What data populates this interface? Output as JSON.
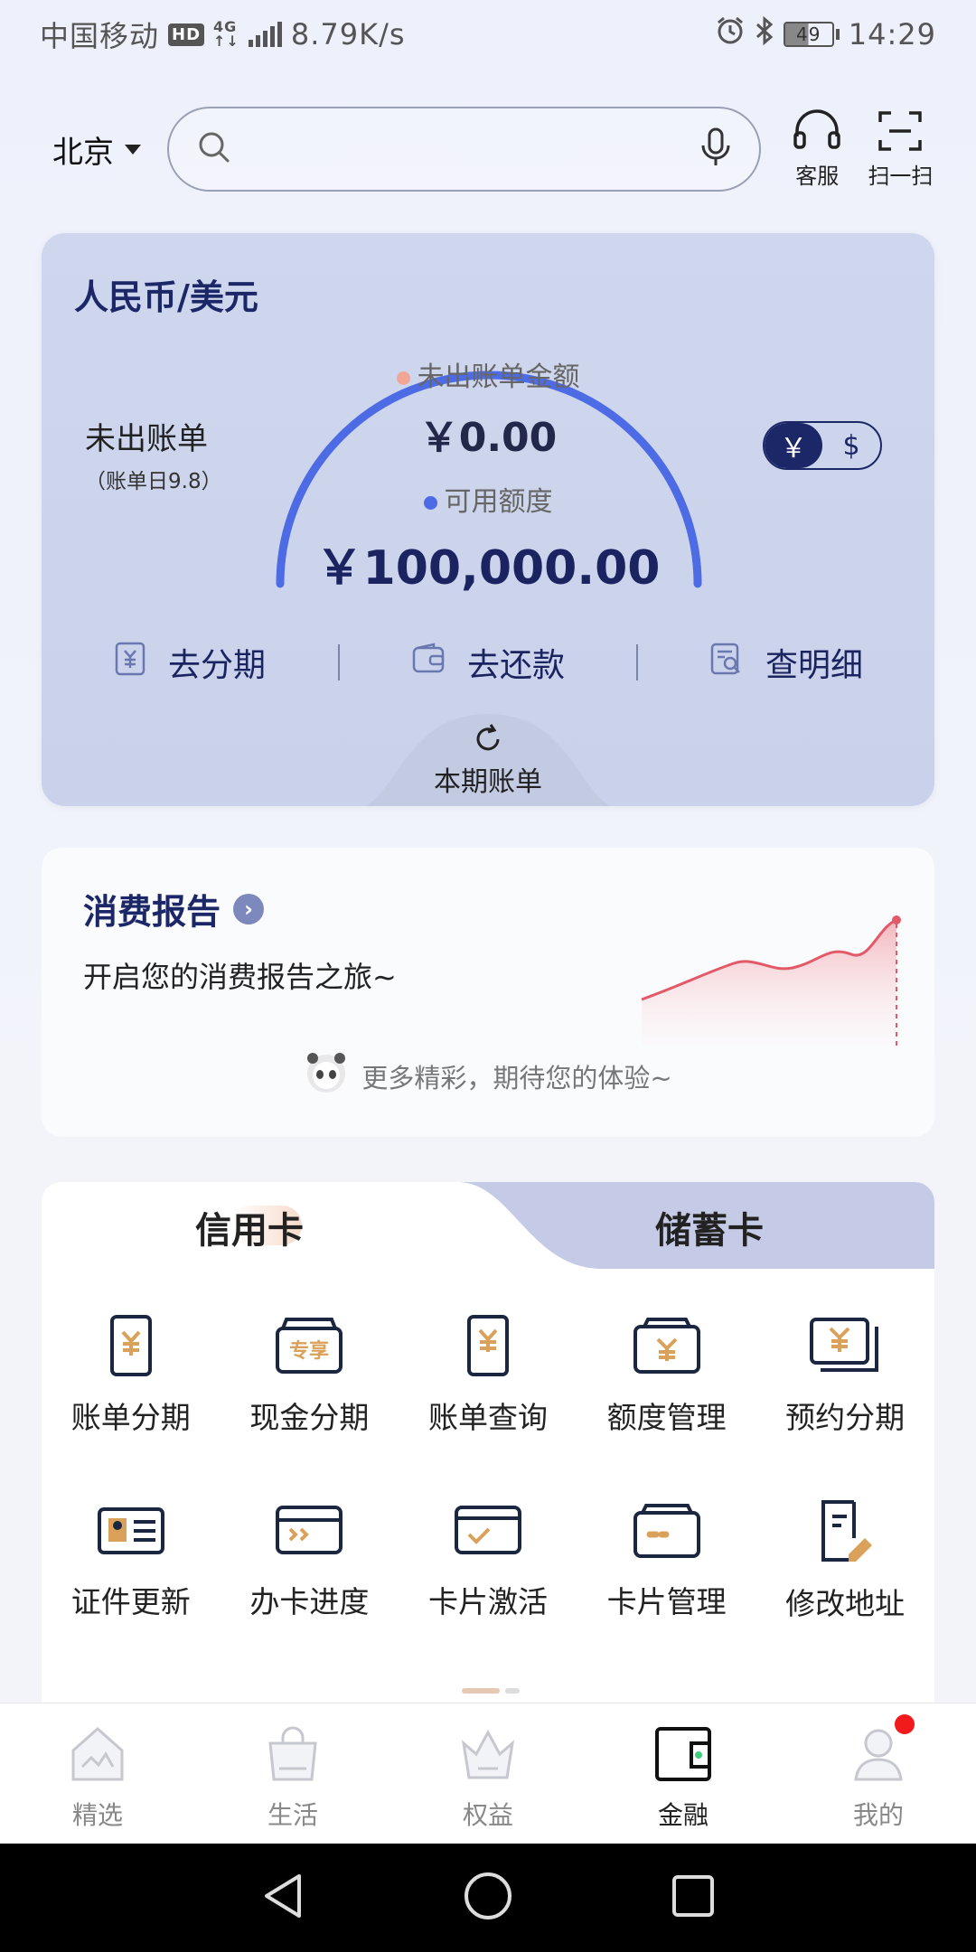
{
  "status_bar": {
    "carrier": "中国移动",
    "hd": "HD",
    "net_type_top": "4G",
    "net_type_bottom": "↑↓",
    "speed": "8.79K/s",
    "battery": "49",
    "time": "14:29"
  },
  "header": {
    "city": "北京",
    "search_placeholder": "",
    "service_label": "客服",
    "scan_label": "扫一扫"
  },
  "bill_card": {
    "title": "人民币/美元",
    "unbilled_label": "未出账单",
    "unbilled_sub": "（账单日9.8）",
    "unbilled_amount_label": "未出账单金额",
    "unbilled_amount": "￥0.00",
    "available_label": "可用额度",
    "available_amount": "￥100,000.00",
    "toggle_cny": "￥",
    "toggle_usd": "$",
    "actions": [
      {
        "label": "去分期",
        "icon": "yuan-document-icon"
      },
      {
        "label": "去还款",
        "icon": "wallet-icon"
      },
      {
        "label": "查明细",
        "icon": "search-document-icon"
      }
    ],
    "current_bill_label": "本期账单"
  },
  "report": {
    "title": "消费报告",
    "subtitle": "开启您的消费报告之旅~",
    "footer": "更多精彩，期待您的体验~"
  },
  "cards": {
    "tab_credit": "信用卡",
    "tab_debit": "储蓄卡",
    "row1": [
      {
        "label": "账单分期",
        "icon": "bill-installment-icon"
      },
      {
        "label": "现金分期",
        "icon": "cash-installment-icon"
      },
      {
        "label": "账单查询",
        "icon": "bill-query-icon"
      },
      {
        "label": "额度管理",
        "icon": "limit-management-icon"
      },
      {
        "label": "预约分期",
        "icon": "scheduled-installment-icon"
      }
    ],
    "row2": [
      {
        "label": "证件更新",
        "icon": "id-card-icon"
      },
      {
        "label": "办卡进度",
        "icon": "card-progress-icon"
      },
      {
        "label": "卡片激活",
        "icon": "card-activate-icon"
      },
      {
        "label": "卡片管理",
        "icon": "card-manage-icon"
      },
      {
        "label": "修改地址",
        "icon": "edit-address-icon"
      }
    ]
  },
  "bottom_nav": [
    {
      "label": "精选",
      "icon": "home-icon"
    },
    {
      "label": "生活",
      "icon": "shopping-bag-icon"
    },
    {
      "label": "权益",
      "icon": "crown-icon"
    },
    {
      "label": "金融",
      "icon": "wallet-icon",
      "active": true
    },
    {
      "label": "我的",
      "icon": "user-icon"
    }
  ],
  "colors": {
    "primary": "#1b2767",
    "gauge": "#4e6be6",
    "badge": "#f21b1b",
    "accent_gold": "#d9a15a"
  }
}
